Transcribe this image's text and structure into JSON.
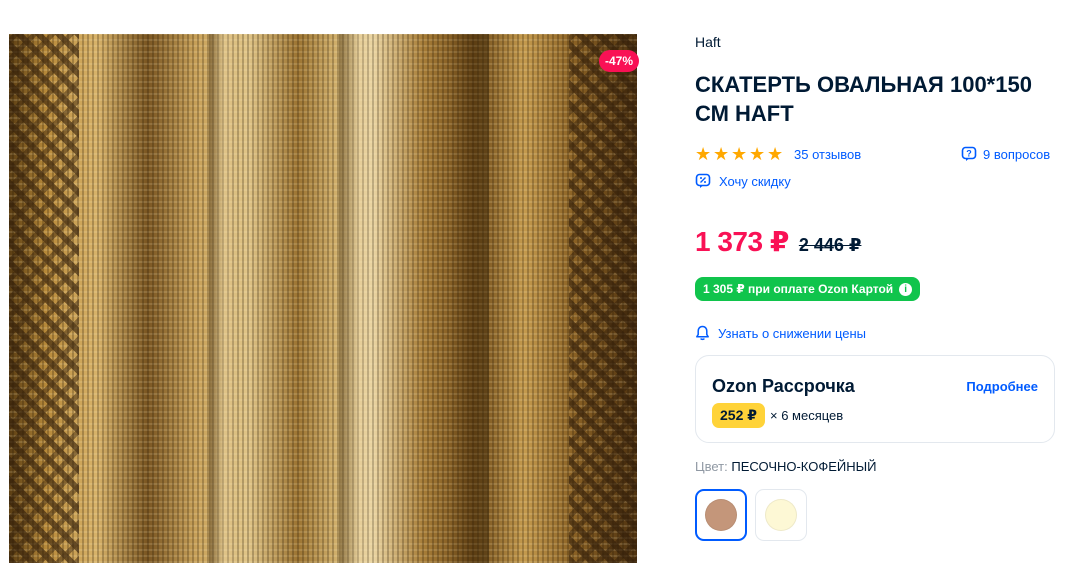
{
  "product": {
    "image_alt": "tablecloth-photo",
    "discount_badge": "-47%",
    "brand": "Haft",
    "title": "СКАТЕРТЬ ОВАЛЬНАЯ 100*150 СМ HAFT"
  },
  "rating": {
    "stars": 5,
    "reviews_label": "35 отзывов",
    "questions_label": "9 вопросов"
  },
  "discount_link": "Хочу скидку",
  "price": {
    "current": "1 373 ₽",
    "old": "2 446 ₽",
    "card_price_label": "1 305 ₽ при оплате Ozon Картой",
    "notify_label": "Узнать о снижении цены"
  },
  "installment": {
    "title": "Ozon Рассрочка",
    "more_label": "Подробнее",
    "monthly": "252 ₽",
    "months": "× 6 месяцев"
  },
  "color": {
    "label": "Цвет:",
    "value": "ПЕСОЧНО-КОФЕЙНЫЙ",
    "swatches": [
      {
        "name": "sand-coffee",
        "hex": "#c4967a",
        "selected": true
      },
      {
        "name": "cream",
        "hex": "#fdf8d5",
        "selected": false
      }
    ]
  },
  "colors": {
    "accent": "#005bff",
    "price": "#f91155",
    "card_badge": "#10c44c",
    "installment_badge": "#ffd339",
    "star": "#ffa800"
  }
}
